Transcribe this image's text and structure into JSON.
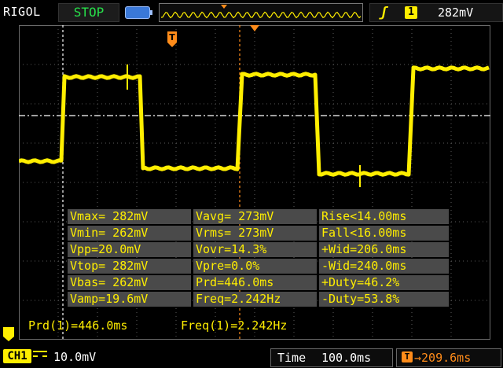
{
  "header": {
    "brand": "RIGOL",
    "run_state": "STOP",
    "trigger_source": "1",
    "trigger_level": "282mV"
  },
  "colors": {
    "trace": "#ffee00",
    "trigger_marker": "#ff8c1a",
    "grid": "#5a5a5a",
    "stop": "#27e04a"
  },
  "measurements": [
    [
      "Vmax= 282mV",
      "Vavg= 273mV",
      "Rise<14.00ms"
    ],
    [
      "Vmin= 262mV",
      "Vrms= 273mV",
      "Fall<16.00ms"
    ],
    [
      "Vpp=20.0mV",
      "Vovr=14.3%",
      "+Wid=206.0ms"
    ],
    [
      "Vtop= 282mV",
      "Vpre=0.0%",
      "-Wid=240.0ms"
    ],
    [
      "Vbas= 262mV",
      "Prd=446.0ms",
      "+Duty=46.2%"
    ],
    [
      "Vamp=19.6mV",
      "Freq=2.242Hz",
      "-Duty=53.8%"
    ]
  ],
  "cursor_readouts": {
    "prd": "Prd(1)=446.0ms",
    "freq": "Freq(1)=2.242Hz"
  },
  "footer": {
    "channel": "CH1",
    "channel_scale": "10.0mV",
    "timebase_label": "Time",
    "timebase_value": "100.0ms",
    "trigger_delay": "→209.6ms"
  },
  "waveform_levels_mV": {
    "high": 282,
    "low": 262,
    "trigger": 273
  }
}
